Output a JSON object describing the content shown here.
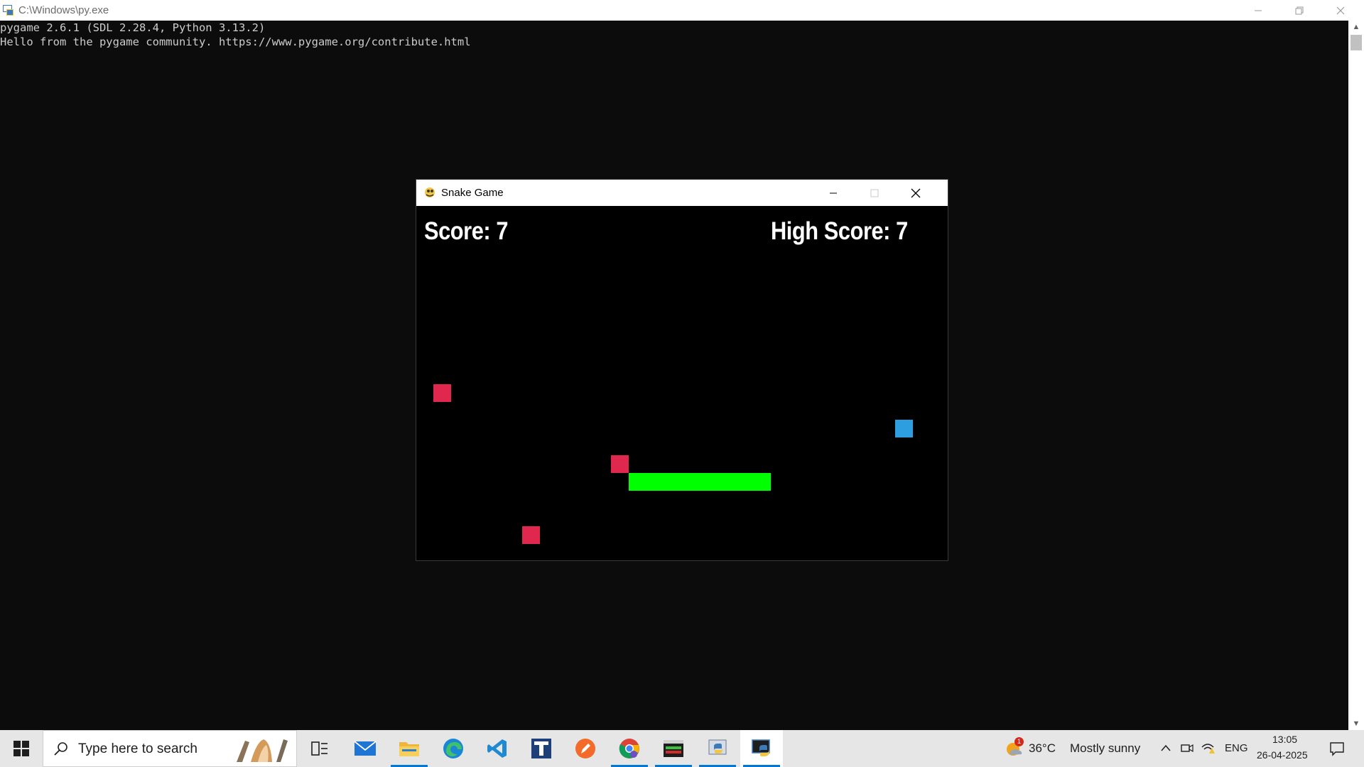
{
  "console": {
    "title": "C:\\Windows\\py.exe",
    "lines": [
      "pygame 2.6.1 (SDL 2.28.4, Python 3.13.2)",
      "Hello from the pygame community. https://www.pygame.org/contribute.html"
    ]
  },
  "game": {
    "title": "Snake Game",
    "score_label": "Score: 7",
    "high_score_label": "High Score: 7",
    "score": 7,
    "high_score": 7,
    "colors": {
      "snake": "#00ff00",
      "red_block": "#e0284f",
      "blue_block": "#2d9ee0",
      "background": "#000000"
    }
  },
  "taskbar": {
    "search_placeholder": "Type here to search",
    "apps": [
      "task-view-icon",
      "mail-icon",
      "file-explorer-icon",
      "edge-icon",
      "vscode-icon",
      "typora-icon",
      "pencil-app-icon",
      "chrome-icon",
      "terminal-icon",
      "python-idle-icon",
      "python-console-icon"
    ],
    "weather_temp": "36°C",
    "weather_desc": "Mostly sunny",
    "weather_badge": "1",
    "language": "ENG",
    "time": "13:05",
    "date": "26-04-2025"
  }
}
